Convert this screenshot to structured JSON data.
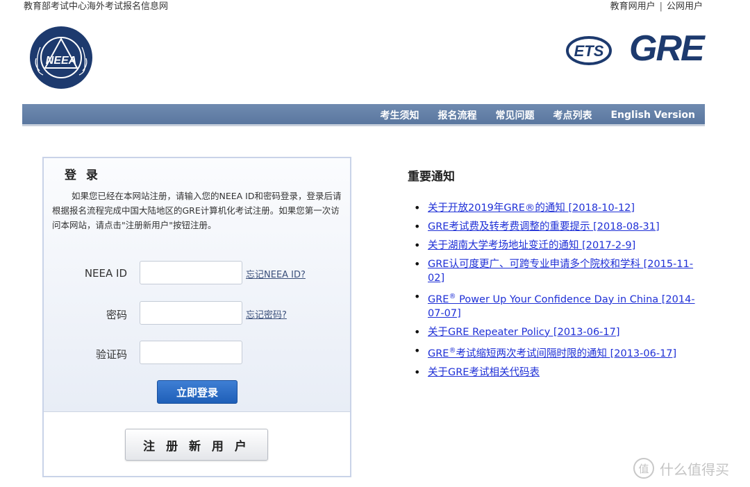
{
  "header": {
    "site_name": "教育部考试中心海外考试报名信息网",
    "user_links": [
      "教育网用户",
      "公网用户"
    ],
    "separator": "|",
    "neea_logo_text": "NEEA",
    "ets_logo_text": "ETS",
    "gre_logo_text": "GRE",
    "logo_color": "#1d3a6e"
  },
  "nav": {
    "items": [
      "考生须知",
      "报名流程",
      "常见问题",
      "考点列表",
      "English Version"
    ],
    "bg_color": "#5f7ca4"
  },
  "login": {
    "title": "登 录",
    "description": "如果您已经在本网站注册，请输入您的NEEA ID和密码登录，登录后请根据报名流程完成中国大陆地区的GRE计算机化考试注册。如果您第一次访问本网站，请点击\"注册新用户\"按钮注册。",
    "fields": [
      {
        "label": "NEEA ID",
        "value": "",
        "forgot": "忘记NEEA ID?"
      },
      {
        "label": "密码",
        "value": "",
        "forgot": "忘记密码?"
      },
      {
        "label": "验证码",
        "value": ""
      }
    ],
    "login_button": "立即登录",
    "register_button": "注 册 新 用 户",
    "button_color": "#2a6cc6"
  },
  "notices": {
    "title": "重要通知",
    "items": [
      {
        "pre": "关于开放2019年GRE®的通知 [2018-10-12]"
      },
      {
        "pre": "GRE考试费及转考费调整的重要提示 [2018-08-31]"
      },
      {
        "pre": "关于湖南大学考场地址变迁的通知 [2017-2-9]"
      },
      {
        "pre": "GRE认可度更广、可跨专业申请多个院校和学科 [2015-11-02]"
      },
      {
        "pre": "GRE",
        "sup": "®",
        "post": " Power Up Your Confidence Day in China [2014-07-07]"
      },
      {
        "pre": "关于GRE Repeater Policy [2013-06-17]"
      },
      {
        "pre": "GRE",
        "sup": "®",
        "post": "考试缩短两次考试间隔时限的通知 [2013-06-17]"
      },
      {
        "pre": "关于GRE考试相关代码表"
      }
    ],
    "link_color": "#1e2fd6"
  },
  "watermark": {
    "icon_text": "值",
    "text": "什么值得买"
  }
}
